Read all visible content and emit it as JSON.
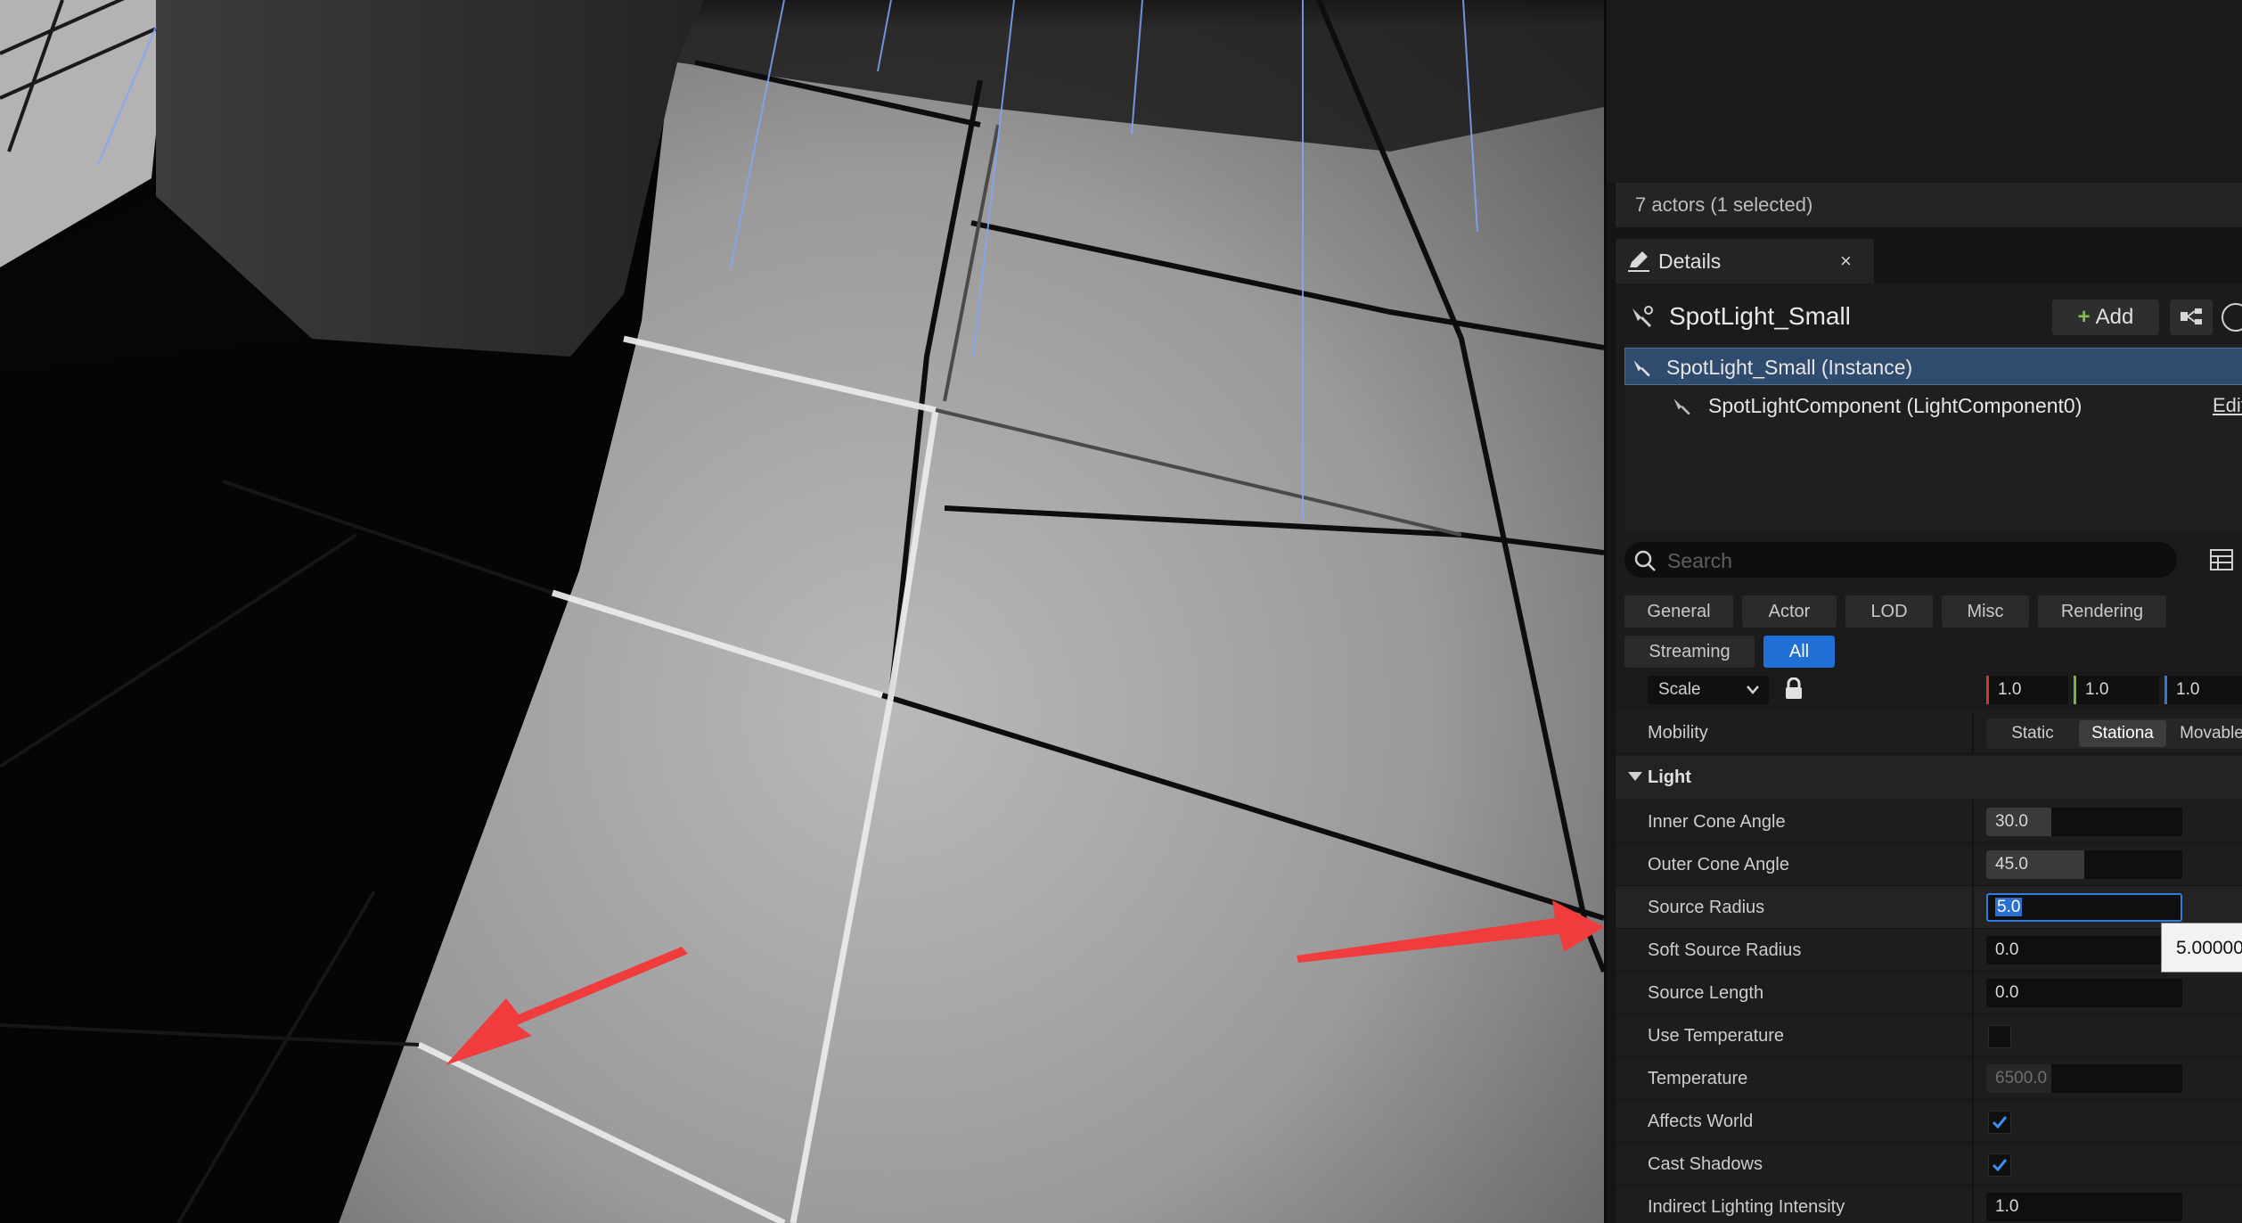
{
  "panel": {
    "actors_status": "7 actors (1 selected)",
    "tab_title": "Details",
    "tab_close": "×",
    "object_name": "SpotLight_Small",
    "add_button": "Add",
    "add_plus": "+",
    "tree": {
      "instance": "SpotLight_Small (Instance)",
      "component": "SpotLightComponent (LightComponent0)",
      "edit_link": "Edit"
    },
    "search_placeholder": "Search",
    "filters": [
      "General",
      "Actor",
      "LOD",
      "Misc",
      "Rendering",
      "Streaming",
      "All"
    ],
    "active_filter": "All",
    "scale": {
      "label": "Scale",
      "x": "1.0",
      "y": "1.0",
      "z": "1.0"
    },
    "mobility": {
      "label": "Mobility",
      "options": [
        "Static",
        "Stationa",
        "Movable"
      ],
      "selected": "Stationa"
    },
    "section_light": "Light",
    "properties": [
      {
        "label": "Inner Cone Angle",
        "value": "30.0",
        "slider_fraction": 0.33
      },
      {
        "label": "Outer Cone Angle",
        "value": "45.0",
        "slider_fraction": 0.5
      },
      {
        "label": "Source Radius",
        "value": "5.0",
        "editing": true
      },
      {
        "label": "Soft Source Radius",
        "value": "0.0"
      },
      {
        "label": "Source Length",
        "value": "0.0"
      },
      {
        "label": "Use Temperature",
        "checked": false
      },
      {
        "label": "Temperature",
        "value": "6500.0",
        "disabled": true
      },
      {
        "label": "Affects World",
        "checked": true
      },
      {
        "label": "Cast Shadows",
        "checked": true
      },
      {
        "label": "Indirect Lighting Intensity",
        "value": "1.0"
      }
    ],
    "tooltip_value": "5.00000"
  },
  "colors": {
    "accent_blue": "#1f6fd6",
    "selection_row": "#2f4b6d",
    "arrow_red": "#f03c3c",
    "add_green": "#7fc24a"
  }
}
